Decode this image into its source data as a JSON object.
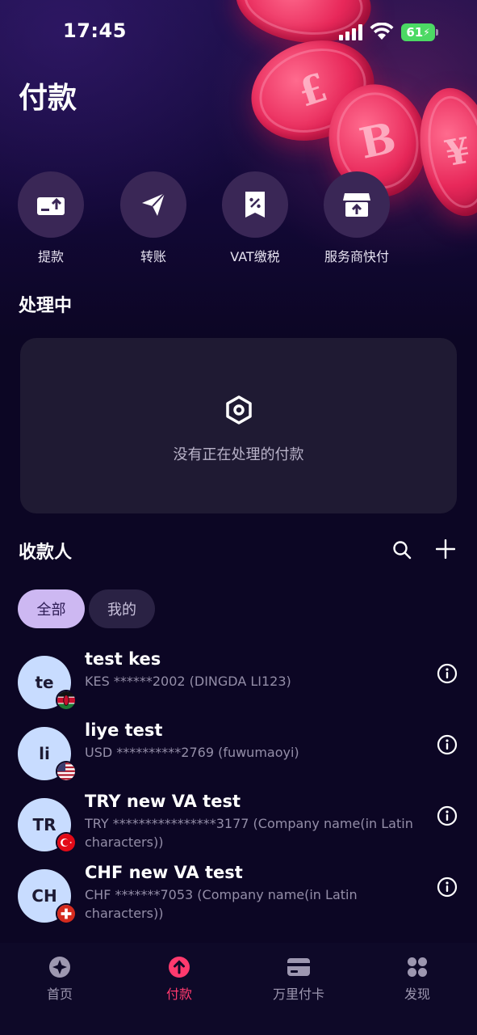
{
  "status_bar": {
    "time": "17:45",
    "battery": "61"
  },
  "page": {
    "title": "付款"
  },
  "quick_actions": [
    {
      "label": "提款",
      "icon": "withdraw-icon"
    },
    {
      "label": "转账",
      "icon": "paper-plane-icon"
    },
    {
      "label": "VAT缴税",
      "icon": "tax-receipt-icon"
    },
    {
      "label": "服务商快付",
      "icon": "storefront-icon"
    }
  ],
  "processing": {
    "title": "处理中",
    "empty_text": "没有正在处理的付款",
    "empty_icon": "hexagon-icon"
  },
  "payees": {
    "title": "收款人",
    "filters": [
      {
        "label": "全部",
        "active": true
      },
      {
        "label": "我的",
        "active": false
      }
    ],
    "items": [
      {
        "initials": "te",
        "name": "test kes",
        "detail": "KES ******2002 (DINGDA LI123)",
        "flag": "kenya-flag-icon"
      },
      {
        "initials": "li",
        "name": "liye test",
        "detail": "USD **********2769 (fuwumaoyi)",
        "flag": "usa-flag-icon"
      },
      {
        "initials": "TR",
        "name": "TRY new VA test",
        "detail": "TRY ****************3177 (Company name(in Latin characters))",
        "flag": "turkey-flag-icon"
      },
      {
        "initials": "CH",
        "name": "CHF new VA test",
        "detail": "CHF *******7053 (Company name(in Latin characters))",
        "flag": "switzerland-flag-icon"
      }
    ]
  },
  "tabbar": {
    "items": [
      {
        "label": "首页",
        "icon": "home-compass-icon",
        "active": false
      },
      {
        "label": "付款",
        "icon": "payment-arrow-icon",
        "active": true
      },
      {
        "label": "万里付卡",
        "icon": "card-icon",
        "active": false
      },
      {
        "label": "发现",
        "icon": "discover-grid-icon",
        "active": false
      }
    ]
  },
  "colors": {
    "background": "#0c0624",
    "accent": "#ff3a6e",
    "chip_active": "#cdb8f2",
    "avatar": "#c8dcff",
    "action_circle": "#3a2756",
    "card": "#1f1a33"
  }
}
